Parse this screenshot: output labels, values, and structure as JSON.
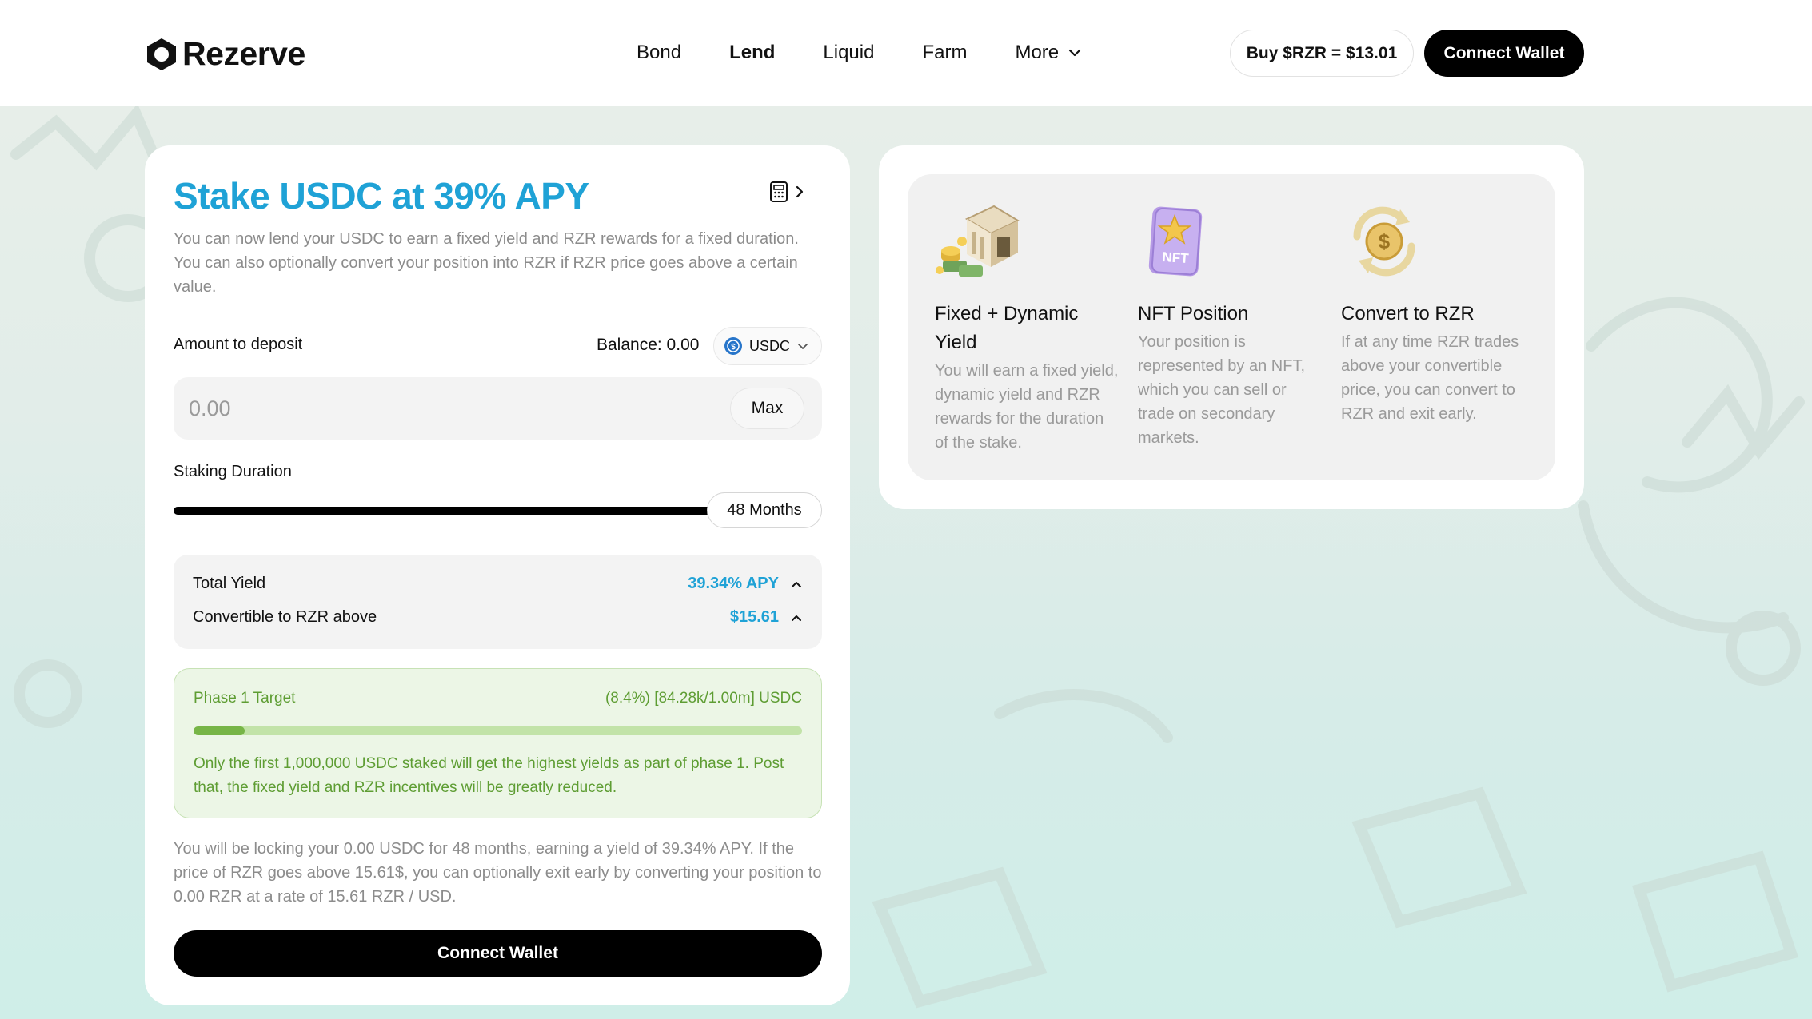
{
  "header": {
    "logo_text": "Rezerve",
    "nav": [
      {
        "label": "Bond",
        "active": false
      },
      {
        "label": "Lend",
        "active": true
      },
      {
        "label": "Liquid",
        "active": false
      },
      {
        "label": "Farm",
        "active": false
      }
    ],
    "more_label": "More",
    "buy_label": "Buy $RZR = $13.01",
    "connect_label": "Connect Wallet"
  },
  "stake": {
    "title": "Stake USDC at 39% APY",
    "description": "You can now lend your USDC to earn a fixed yield and RZR rewards for a fixed duration. You can also optionally convert your position into RZR if RZR price goes above a certain value.",
    "amount_label": "Amount to deposit",
    "balance_label": "Balance: 0.00",
    "token": "USDC",
    "amount_placeholder": "0.00",
    "max_label": "Max",
    "duration_label": "Staking Duration",
    "duration_value": "48 Months",
    "duration_fraction": 1.0,
    "total_yield_label": "Total Yield",
    "total_yield_value": "39.34% APY",
    "convertible_label": "Convertible to RZR above",
    "convertible_value": "$15.61",
    "phase": {
      "title": "Phase 1 Target",
      "stat": "(8.4%) [84.28k/1.00m] USDC",
      "progress_fraction": 0.084,
      "description": "Only the first 1,000,000 USDC staked will get the highest yields as part of phase 1. Post that, the fixed yield and RZR incentives will be greatly reduced."
    },
    "summary": "You will be locking your 0.00 USDC for 48 months, earning a yield of 39.34% APY. If the price of RZR goes above 15.61$, you can optionally exit early by converting your position to 0.00 RZR at a rate of 15.61 RZR / USD.",
    "connect_label": "Connect Wallet"
  },
  "features": [
    {
      "icon": "bank-icon",
      "title": "Fixed + Dynamic Yield",
      "description": "You will earn a fixed yield, dynamic yield and RZR rewards for the duration of the stake."
    },
    {
      "icon": "nft-icon",
      "title": "NFT Position",
      "description": "Your position is represented by an NFT, which you can sell or trade on secondary markets."
    },
    {
      "icon": "convert-icon",
      "title": "Convert to RZR",
      "description": "If at any time RZR trades above your convertible price, you can convert to RZR and exit early."
    }
  ],
  "colors": {
    "accent": "#1fa2d6",
    "phase_text": "#5e9d33",
    "phase_bg": "#ecf6e6",
    "button_bg": "#000000"
  }
}
